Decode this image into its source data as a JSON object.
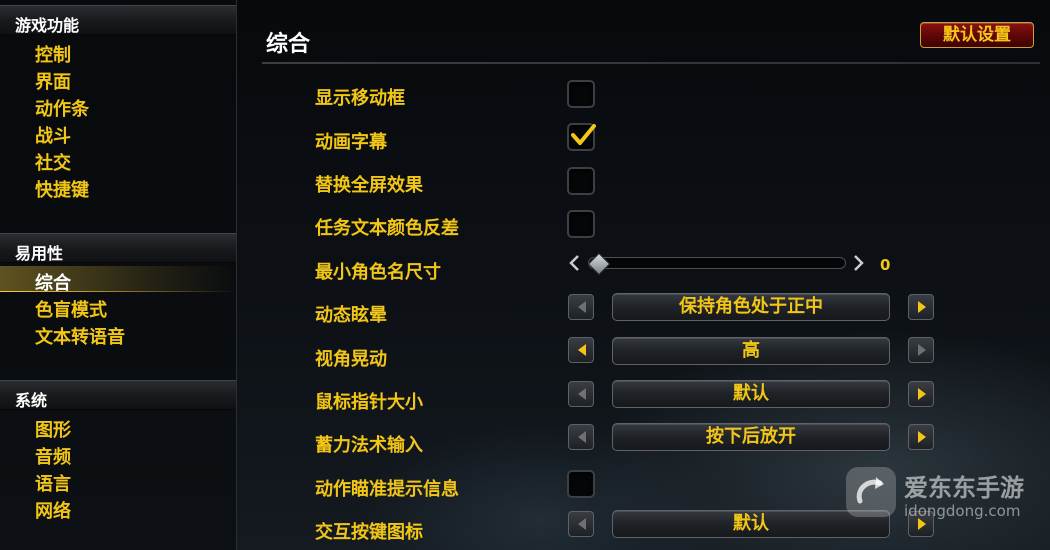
{
  "sidebar": {
    "sections": [
      {
        "title": "游戏功能",
        "items": [
          "控制",
          "界面",
          "动作条",
          "战斗",
          "社交",
          "快捷键"
        ]
      },
      {
        "title": "易用性",
        "items": [
          "综合",
          "色盲模式",
          "文本转语音"
        ]
      },
      {
        "title": "系统",
        "items": [
          "图形",
          "音频",
          "语言",
          "网络"
        ]
      }
    ],
    "selected_item": "综合"
  },
  "main": {
    "title": "综合",
    "default_button": "默认设置",
    "options": {
      "show_move_pad": {
        "label": "显示移动框",
        "checked": false
      },
      "cinematic_subtitles": {
        "label": "动画字幕",
        "checked": true
      },
      "alternate_fullscreen_effects": {
        "label": "替换全屏效果",
        "checked": false
      },
      "quest_text_contrast": {
        "label": "任务文本颜色反差",
        "checked": false
      },
      "min_character_name_size": {
        "label": "最小角色名尺寸",
        "value": "0"
      },
      "motion_sickness": {
        "label": "动态眩晕",
        "value": "保持角色处于正中"
      },
      "camera_shake": {
        "label": "视角晃动",
        "value": "高"
      },
      "cursor_size": {
        "label": "鼠标指针大小",
        "value": "默认"
      },
      "empowered_spell_input": {
        "label": "蓄力法术输入",
        "value": "按下后放开"
      },
      "target_tooltip": {
        "label": "动作瞄准提示信息",
        "checked": false
      },
      "interact_key_icons": {
        "label": "交互按键图标",
        "value": "默认"
      }
    }
  },
  "watermark": {
    "brand": "爱东东手游",
    "url": "idongdong.com"
  },
  "colors": {
    "accent": "#f2c616",
    "panel": "#0b0f14",
    "button_red": "#6e0808"
  }
}
